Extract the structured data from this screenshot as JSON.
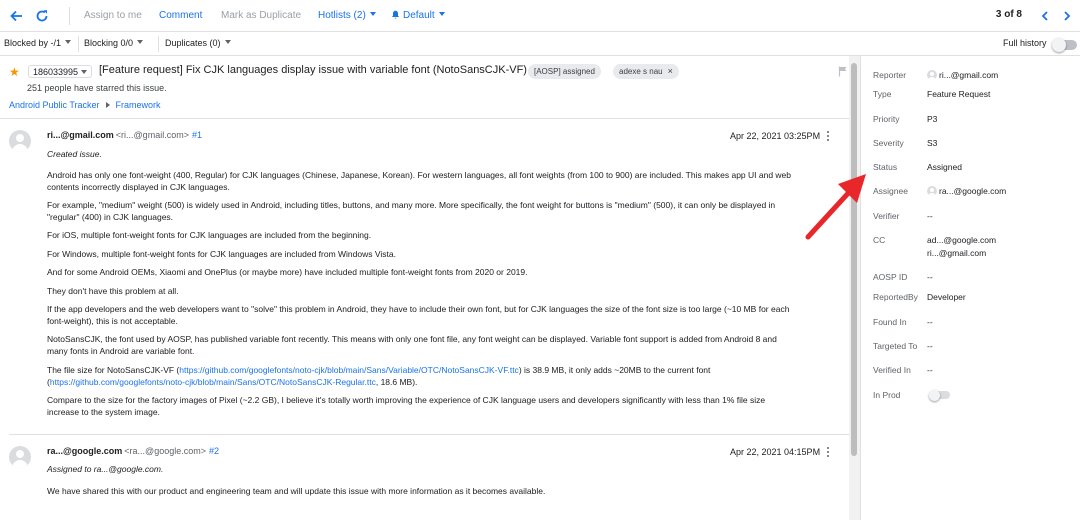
{
  "toolbar": {
    "assign_to_me": "Assign to me",
    "comment": "Comment",
    "mark_duplicate": "Mark as Duplicate",
    "hotlists": "Hotlists (2)",
    "notification": "Default",
    "pager": "3 of 8",
    "accent_color": "#1a73e8"
  },
  "filters": {
    "blocked_by": "Blocked by -/1",
    "blocking": "Blocking 0/0",
    "duplicates": "Duplicates (0)",
    "full_history": "Full history"
  },
  "issue": {
    "id": "186033995",
    "title": "[Feature request] Fix CJK languages display issue with variable font (NotoSansCJK-VF)",
    "status_chip": "[AOSP] assigned",
    "user_chip": "adexe s nau",
    "starred": "251 people have starred this issue.",
    "breadcrumb": [
      "Android Public Tracker",
      "Framework"
    ]
  },
  "comments": [
    {
      "author": "ri...@gmail.com",
      "email": "<ri...@gmail.com>",
      "number": "#1",
      "date": "Apr 22, 2021 03:25PM",
      "lines": [
        "Created issue.",
        "Android has only one font-weight (400, Regular) for CJK languages (Chinese, Japanese, Korean). For western languages, all font weights (from 100 to 900) are included. This makes app UI and web",
        "contents incorrectly displayed in CJK languages.",
        "For example, \"medium\" weight (500) is widely used in Android, including titles, buttons, and many more. More specifically, the font weight for buttons is \"medium\" (500), it can only be displayed in",
        "\"regular\" (400) in CJK languages.",
        "For iOS, multiple font-weight fonts for CJK languages are included from the beginning.",
        "For Windows, multiple font-weight fonts for CJK languages are included from Windows Vista.",
        "And for some Android OEMs, Xiaomi and OnePlus (or maybe more) have included multiple font-weight fonts from 2020 or 2019.",
        "They don't have this problem at all.",
        "If the app developers and the web developers want to \"solve\" this problem in Android, they have to include their own font, but for CJK languages the size of the font size is too large (~10 MB for each",
        "font-weight), this is not acceptable.",
        "NotoSansCJK, the font used by AOSP, has published variable font recently. This means with only one font file, any font weight can be displayed. Variable font support is added from Android 8 and",
        "many fonts in Android are variable font."
      ],
      "size_line": {
        "prefix": "The file size for NotoSansCJK-VF (",
        "link1": "https://github.com/googlefonts/noto-cjk/blob/main/Sans/Variable/OTC/NotoSansCJK-VF.ttc",
        "middle": ") is 38.9 MB, it only adds ~20MB to the current font",
        "open": "(",
        "link2": "https://github.com/googlefonts/noto-cjk/blob/main/Sans/OTC/NotoSansCJK-Regular.ttc",
        "suffix": ", 18.6 MB)."
      },
      "closing": [
        "Compare to the size for the factory images of Pixel (~2.2 GB), I believe it's totally worth improving the experience of CJK language users and developers significantly with less than 1% file size",
        "increase to the system image."
      ]
    },
    {
      "author": "ra...@google.com",
      "email": "<ra...@google.com>",
      "number": "#2",
      "date": "Apr 22, 2021 04:15PM",
      "lines": [
        "Assigned to ra...@google.com.",
        "We have shared this with our product and engineering team and will update this issue with more information as it becomes available."
      ]
    }
  ],
  "fields": {
    "reporter": {
      "label": "Reporter",
      "value": "ri...@gmail.com"
    },
    "type": {
      "label": "Type",
      "value": "Feature Request"
    },
    "priority": {
      "label": "Priority",
      "value": "P3"
    },
    "severity": {
      "label": "Severity",
      "value": "S3"
    },
    "status": {
      "label": "Status",
      "value": "Assigned"
    },
    "assignee": {
      "label": "Assignee",
      "value": "ra...@google.com"
    },
    "verifier": {
      "label": "Verifier",
      "value": "--"
    },
    "cc": {
      "label": "CC",
      "values": [
        "ad...@google.com",
        "ri...@gmail.com"
      ]
    },
    "aosp_id": {
      "label": "AOSP ID",
      "value": "--"
    },
    "reported_by": {
      "label": "ReportedBy",
      "value": "Developer"
    },
    "found_in": {
      "label": "Found In",
      "value": "--"
    },
    "targeted_to": {
      "label": "Targeted To",
      "value": "--"
    },
    "verified_in": {
      "label": "Verified In",
      "value": "--"
    },
    "in_prod": {
      "label": "In Prod",
      "enabled": false
    }
  },
  "annotation": {
    "icon": "red-arrow-icon",
    "color": "#e8272b"
  }
}
